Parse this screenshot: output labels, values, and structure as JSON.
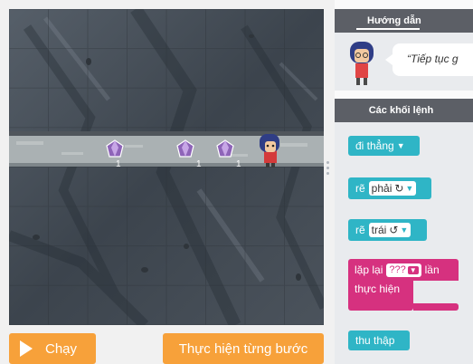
{
  "game": {
    "gem_counts": [
      "1",
      "1",
      "1"
    ]
  },
  "controls": {
    "run_label": "Chạy",
    "step_label": "Thực hiện từng bước"
  },
  "panel": {
    "guide_tab": "Hướng dẫn",
    "guide_text": "“Tiếp tục g",
    "blocks_tab": "Các khối lệnh"
  },
  "blocks": {
    "move": {
      "label": "đi thẳng"
    },
    "turn_right": {
      "label": "rẽ",
      "option": "phải"
    },
    "turn_left": {
      "label": "rẽ",
      "option": "trái"
    },
    "repeat": {
      "label": "lặp lại",
      "count": "???",
      "times": "lần",
      "do": "thực hiện"
    },
    "collect": {
      "label": "thu thập"
    }
  },
  "colors": {
    "accent_orange": "#f7a13a",
    "block_teal": "#2fb5c6",
    "block_pink": "#d6317f",
    "header_gray": "#5c5f66"
  }
}
